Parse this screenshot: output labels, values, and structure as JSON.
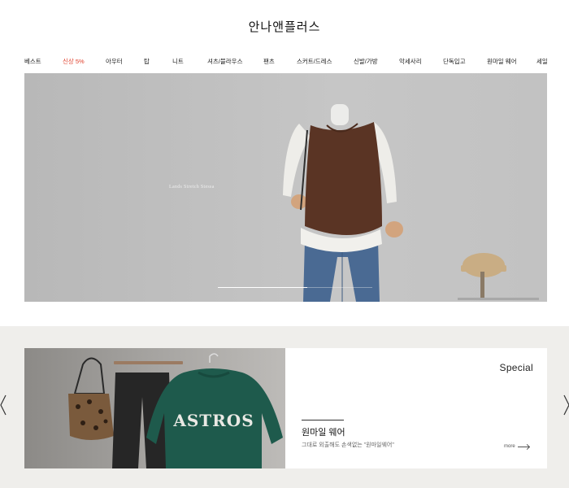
{
  "brand": {
    "logo_text": "안나앤플러스"
  },
  "nav": {
    "items": [
      {
        "label": "베스트"
      },
      {
        "label": "신상 5%"
      },
      {
        "label": "아우터"
      },
      {
        "label": "탑"
      },
      {
        "label": "니트"
      },
      {
        "label": "셔츠/블라우스"
      },
      {
        "label": "팬츠"
      },
      {
        "label": "스커트/드레스"
      },
      {
        "label": "신발/가방"
      },
      {
        "label": "악세사리"
      },
      {
        "label": "단독입고"
      },
      {
        "label": "원마일 웨어"
      },
      {
        "label": "세일"
      }
    ],
    "highlight_color": "#e0402c"
  },
  "hero": {
    "caption": "Lands Stretch Stessa",
    "slide_progress": 0.58
  },
  "special": {
    "label": "Special",
    "title": "원마일 웨어",
    "description": "그대로 외출해도 손색없는 \"원마일웨어\"",
    "more_label": "more",
    "sweatshirt_print": "ASTROS"
  },
  "carousel": {
    "prev_icon": "chevron-left-icon",
    "next_icon": "chevron-right-icon"
  }
}
